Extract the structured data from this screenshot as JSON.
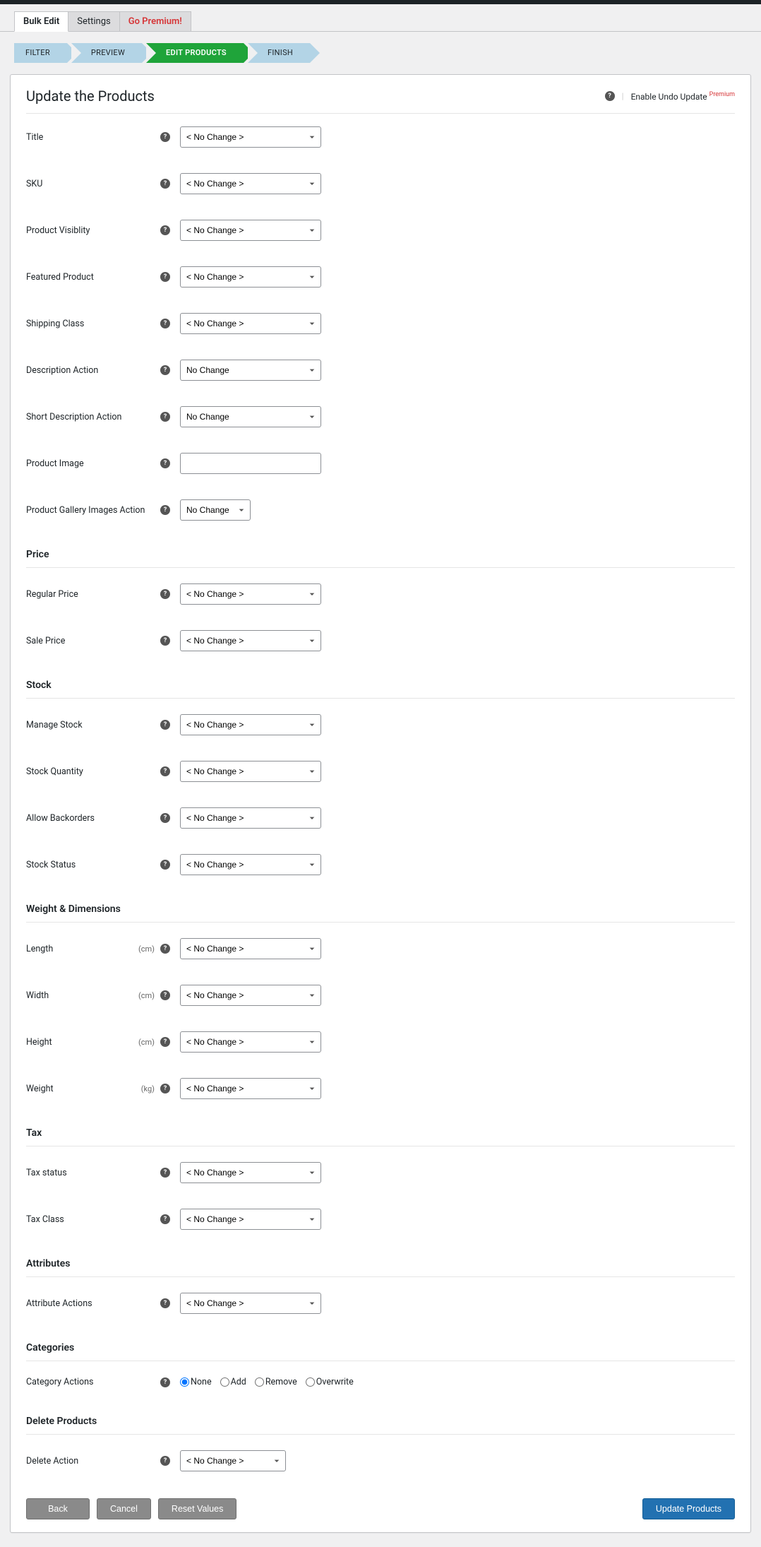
{
  "tabs": {
    "bulk_edit": "Bulk Edit",
    "settings": "Settings",
    "premium": "Go Premium!"
  },
  "steps": {
    "filter": "FILTER",
    "preview": "PREVIEW",
    "edit": "EDIT PRODUCTS",
    "finish": "FINISH"
  },
  "header": {
    "title": "Update the Products",
    "undo_label": "Enable Undo Update",
    "premium_tag": "Premium"
  },
  "opts": {
    "no_change": "< No Change >",
    "no_change_plain": "No Change"
  },
  "labels": {
    "title": "Title",
    "sku": "SKU",
    "visibility": "Product Visiblity",
    "featured": "Featured Product",
    "shipping": "Shipping Class",
    "desc_action": "Description Action",
    "short_desc": "Short Description Action",
    "product_image": "Product Image",
    "gallery": "Product Gallery Images Action"
  },
  "sections": {
    "price": "Price",
    "stock": "Stock",
    "weight": "Weight & Dimensions",
    "tax": "Tax",
    "attributes": "Attributes",
    "categories": "Categories",
    "delete": "Delete Products"
  },
  "price": {
    "regular": "Regular Price",
    "sale": "Sale Price"
  },
  "stock": {
    "manage": "Manage Stock",
    "qty": "Stock Quantity",
    "backorders": "Allow Backorders",
    "status": "Stock Status"
  },
  "dims": {
    "length": "Length",
    "width": "Width",
    "height": "Height",
    "weight": "Weight"
  },
  "units": {
    "cm": "(cm)",
    "kg": "(kg)"
  },
  "tax": {
    "status": "Tax status",
    "class": "Tax Class"
  },
  "attributes": {
    "actions": "Attribute Actions"
  },
  "categories": {
    "actions": "Category Actions",
    "none": "None",
    "add": "Add",
    "remove": "Remove",
    "overwrite": "Overwrite"
  },
  "delete": {
    "action": "Delete Action"
  },
  "buttons": {
    "back": "Back",
    "cancel": "Cancel",
    "reset": "Reset Values",
    "update": "Update Products"
  }
}
